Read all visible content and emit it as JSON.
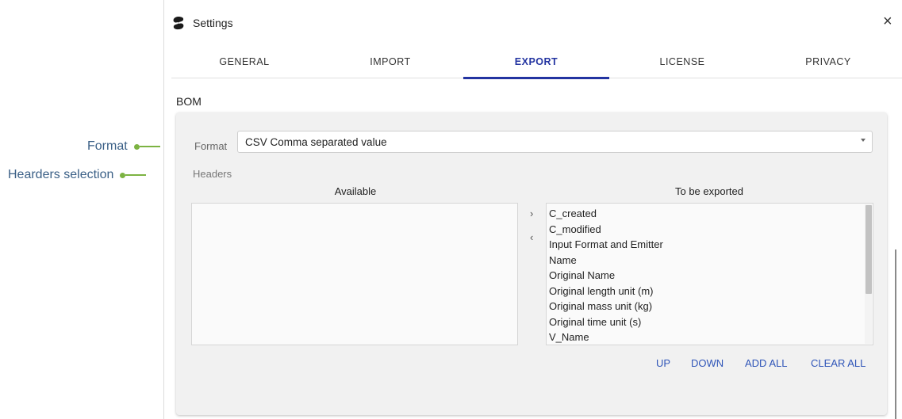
{
  "callouts": {
    "format": "Format",
    "headers": "Hearders selection"
  },
  "window": {
    "title": "Settings",
    "logo_icon": "app-logo-icon",
    "close_icon": "×"
  },
  "tabs": [
    {
      "label": "GENERAL",
      "active": false
    },
    {
      "label": "IMPORT",
      "active": false
    },
    {
      "label": "EXPORT",
      "active": true
    },
    {
      "label": "LICENSE",
      "active": false
    },
    {
      "label": "PRIVACY",
      "active": false
    }
  ],
  "section": {
    "title": "BOM"
  },
  "format": {
    "label": "Format",
    "value": "CSV Comma separated value"
  },
  "headers": {
    "label": "Headers",
    "available_title": "Available",
    "export_title": "To be exported",
    "available_items": [],
    "export_items": [
      "C_created",
      "C_modified",
      "Input Format and Emitter",
      "Name",
      "Original Name",
      "Original length unit (m)",
      "Original mass unit (kg)",
      "Original time unit (s)",
      "V_Name"
    ],
    "move_right": "›",
    "move_left": "‹"
  },
  "actions": {
    "up": "UP",
    "down": "DOWN",
    "add_all": "ADD ALL",
    "clear_all": "CLEAR ALL"
  },
  "colors": {
    "accent": "#2334a1",
    "link": "#2f55b8",
    "callout": "#7cb342"
  }
}
